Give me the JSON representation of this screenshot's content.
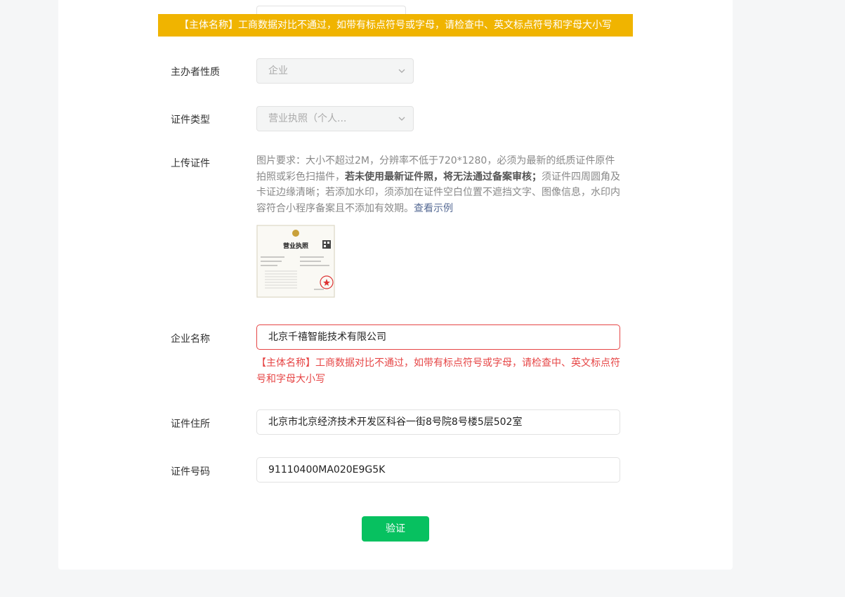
{
  "banner": {
    "text": "【主体名称】工商数据对比不通过，如带有标点符号或字母，请检查中、英文标点符号和字母大小写"
  },
  "form": {
    "organizer_type": {
      "label": "主办者性质",
      "value": "企业"
    },
    "cert_type": {
      "label": "证件类型",
      "value": "营业执照（个人..."
    },
    "upload": {
      "label": "上传证件",
      "desc_part1": "图片要求：大小不超过2M，分辨率不低于720*1280，必须为最新的纸质证件原件拍照或彩色扫描件，",
      "desc_bold": "若未使用最新证件照，将无法通过备案审核；",
      "desc_part2": "须证件四周圆角及卡证边缘清晰；若添加水印，须添加在证件空白位置不遮挡文字、图像信息，水印内容符合小程序备案且不添加有效期。",
      "link": "查看示例",
      "thumb_title": "营业执照"
    },
    "company_name": {
      "label": "企业名称",
      "value": "北京千禧智能技术有限公司",
      "error": "【主体名称】工商数据对比不通过，如带有标点符号或字母，请检查中、英文标点符号和字母大小写"
    },
    "address": {
      "label": "证件住所",
      "value": "北京市北京经济技术开发区科谷一街8号院8号楼5层502室"
    },
    "cert_number": {
      "label": "证件号码",
      "value": "91110400MA020E9G5K"
    }
  },
  "verify_button": "验证",
  "colors": {
    "banner": "#f0b400",
    "error": "#e64545",
    "primary": "#07c160",
    "link": "#576b95"
  }
}
